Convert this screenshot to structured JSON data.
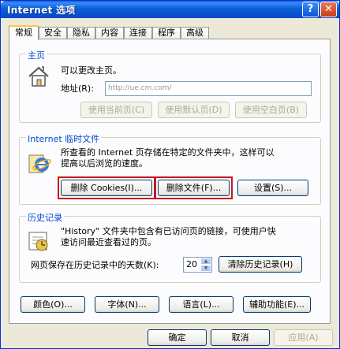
{
  "window": {
    "title": "Internet 选项",
    "help_label": "?",
    "close_label": "✕"
  },
  "tabs": [
    {
      "label": "常规",
      "active": true
    },
    {
      "label": "安全"
    },
    {
      "label": "隐私"
    },
    {
      "label": "内容"
    },
    {
      "label": "连接"
    },
    {
      "label": "程序"
    },
    {
      "label": "高级"
    }
  ],
  "homepage": {
    "title": "主页",
    "description": "可以更改主页。",
    "address_label": "地址(R):",
    "address_value": "http://ue.cm.com/",
    "use_current": "使用当前页(C)",
    "use_default": "使用默认页(D)",
    "use_blank": "使用空白页(B)"
  },
  "temp_files": {
    "title": "Internet 临时文件",
    "description_line1": "所查看的 Internet 页存储在特定的文件夹中，这样可以",
    "description_line2": "提高以后浏览的速度。",
    "delete_cookies": "删除 Cookies(I)...",
    "delete_files": "删除文件(F)...",
    "settings": "设置(S)..."
  },
  "history": {
    "title": "历史记录",
    "description_line1": "\"History\" 文件夹中包含有已访问页的链接，可使用户快",
    "description_line2": "速访问最近查看过的页。",
    "days_label": "网页保存在历史记录中的天数(K):",
    "days_value": "20",
    "clear_history": "清除历史记录(H)"
  },
  "bottom_buttons": {
    "colors": "颜色(O)...",
    "fonts": "字体(N)...",
    "languages": "语言(L)...",
    "accessibility": "辅助功能(E)..."
  },
  "dialog_buttons": {
    "ok": "确定",
    "cancel": "取消",
    "apply": "应用(A)"
  },
  "colors": {
    "titlebar": "#0a5fd8",
    "group_title": "#0046d5",
    "highlight_border": "#c8161e"
  }
}
